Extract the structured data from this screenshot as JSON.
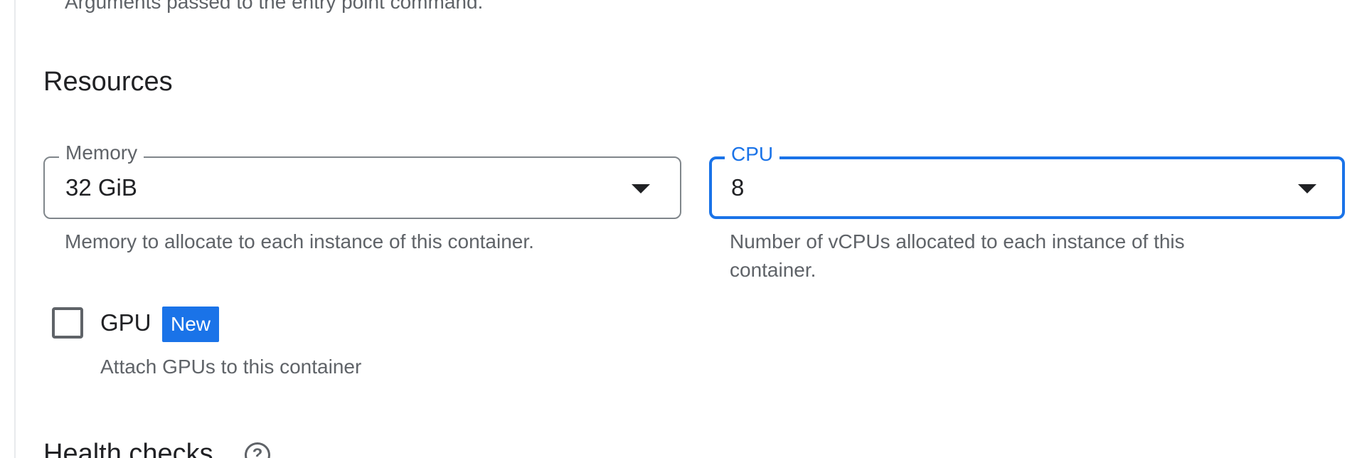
{
  "previous_field": {
    "hint": "Arguments passed to the entry point command."
  },
  "resources": {
    "title": "Resources",
    "memory": {
      "label": "Memory",
      "value": "32 GiB",
      "hint": "Memory to allocate to each instance of this container."
    },
    "cpu": {
      "label": "CPU",
      "value": "8",
      "hint": "Number of vCPUs allocated to each instance of this container."
    },
    "gpu": {
      "label": "GPU",
      "badge": "New",
      "hint": "Attach GPUs to this container",
      "checked": false
    }
  },
  "health_checks": {
    "title": "Health checks",
    "help_icon": "help-circle-icon"
  },
  "colors": {
    "accent": "#1a73e8",
    "text_primary": "#202124",
    "text_secondary": "#5f6368"
  }
}
